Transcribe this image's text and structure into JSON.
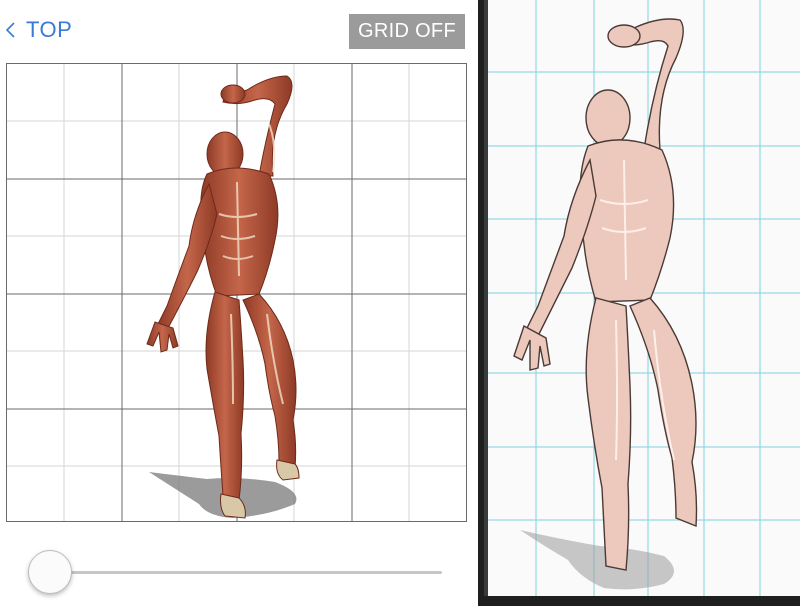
{
  "header": {
    "back_label": "TOP",
    "grid_toggle_label": "GRID OFF"
  },
  "slider": {
    "value": 0
  },
  "icons": {
    "back": "chevron-left-icon"
  },
  "colors": {
    "link": "#3a7bd5",
    "toggle_bg": "#9b9b9b",
    "reference_grid": "#6a6a6a",
    "sketch_grid": "#7fd3de",
    "muscle": "#b8563c",
    "skin_sketch": "#ecc8bd",
    "divider": "#1f1f1f"
  }
}
